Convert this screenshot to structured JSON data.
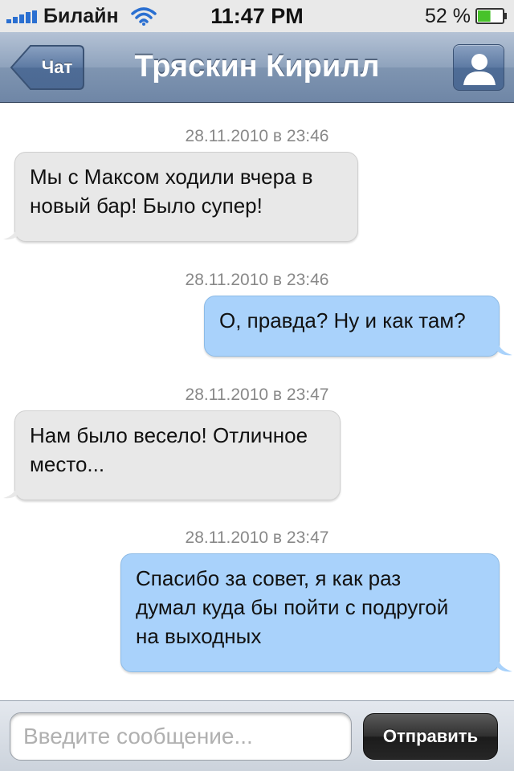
{
  "status_bar": {
    "carrier": "Билайн",
    "time": "11:47 PM",
    "battery_percent": "52 %",
    "battery_level": 0.52,
    "signal_bars": 5,
    "icons": [
      "signal-icon",
      "wifi-icon",
      "battery-icon"
    ]
  },
  "nav": {
    "back_label": "Чат",
    "title": "Тряскин Кирилл",
    "contact_icon": "person-icon"
  },
  "messages": [
    {
      "direction": "in",
      "timestamp": "28.11.2010 в 23:46",
      "lines": [
        "Мы с Максом ходили вчера в",
        "новый бар! Было супер!"
      ]
    },
    {
      "direction": "out",
      "timestamp": "28.11.2010 в 23:46",
      "lines": [
        "О, правда? Ну и как там?"
      ]
    },
    {
      "direction": "in",
      "timestamp": "28.11.2010 в 23:47",
      "lines": [
        "Нам было весело! Отличное",
        "место..."
      ]
    },
    {
      "direction": "out",
      "timestamp": "28.11.2010 в 23:47",
      "lines": [
        "Спасибо за совет, я как раз",
        "думал куда бы пойти с подругой",
        "на выходных"
      ]
    }
  ],
  "input": {
    "placeholder": "Введите сообщение...",
    "value": ""
  },
  "send_label": "Отправить",
  "colors": {
    "incoming_bubble": "#e8e8e8",
    "outgoing_bubble": "#a9d2fb",
    "nav_bar": "#8fa3bd",
    "send_button": "#262626"
  }
}
